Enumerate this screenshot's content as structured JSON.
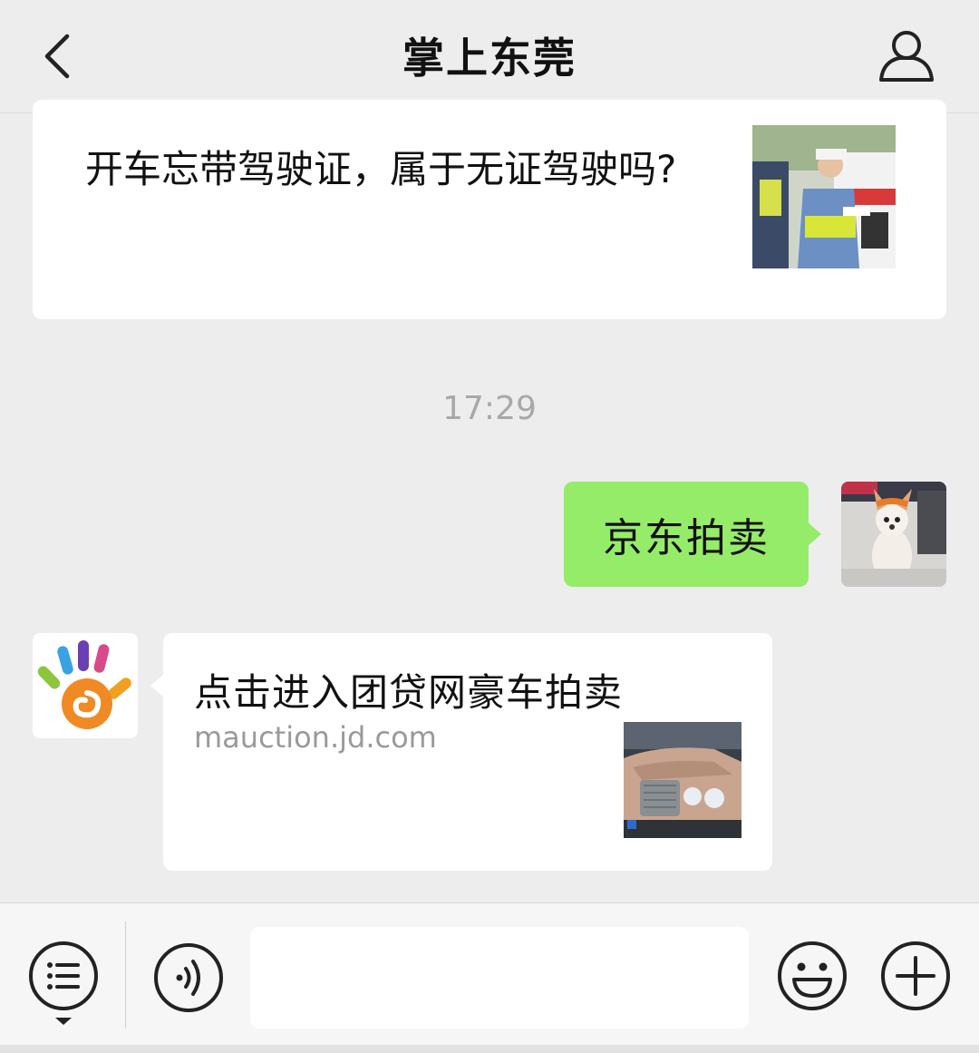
{
  "header": {
    "title": "掌上东莞",
    "back_icon": "chevron-left-icon",
    "profile_icon": "person-icon"
  },
  "article": {
    "title": "开车忘带驾驶证，属于无证驾驶吗?"
  },
  "timestamp": "17:29",
  "outgoing": {
    "text": "京东拍卖"
  },
  "link_card": {
    "title": "点击进入团贷网豪车拍卖",
    "url": "mauction.jd.com"
  },
  "input_bar": {
    "menu_icon": "list-menu-icon",
    "voice_icon": "voice-icon",
    "emoji_icon": "emoji-icon",
    "plus_icon": "plus-icon",
    "placeholder": ""
  },
  "colors": {
    "background": "#ededed",
    "outgoing_bubble": "#95ec69",
    "card": "#ffffff"
  }
}
